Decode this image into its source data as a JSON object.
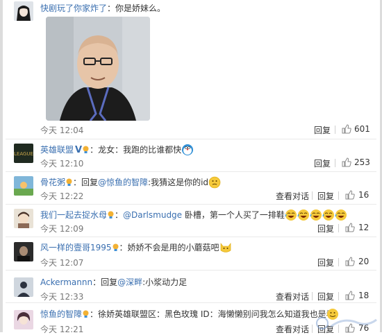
{
  "comments": [
    {
      "user": "快剧玩了你家炸了",
      "text": "：你是娇妹么。",
      "time": "今天 12:04",
      "reply": "回复",
      "likes": "601"
    },
    {
      "user": "英雄联盟",
      "text": "：龙女：我跑的比谁都快",
      "time": "今天 12:10",
      "reply": "回复",
      "likes": "253"
    },
    {
      "user": "骨花粥",
      "reply_prefix": "：回复",
      "mention": "@惊鱼的智障",
      "text": ":我猜这是你的id",
      "time": "今天 12:22",
      "view": "查看对话",
      "reply": "回复",
      "likes": "16"
    },
    {
      "user": "我们一起去捉水母",
      "text_prefix": "：",
      "mention": "@Darlsmudge",
      "text": " 卧槽，第一个人买了一排鞋",
      "time": "今天 12:09",
      "reply": "回复",
      "likes": "12"
    },
    {
      "user": "风一样的壹哥1995",
      "text": "：娇娇不会是用的小蘑菇吧",
      "time": "今天 12:07",
      "reply": "回复",
      "likes": "20"
    },
    {
      "user": "Ackermannn",
      "reply_prefix": "：回复",
      "mention": "@深畔",
      "text": ":小浆动力足",
      "time": "今天 12:33",
      "view": "查看对话",
      "reply": "回复",
      "likes": "18"
    },
    {
      "user": "惊鱼的智障",
      "text": "：徐娇英雄联盟区：黑色玫瑰 ID：海懒懒别问我怎么知道我也是看说的",
      "time": "今天 12:21",
      "view": "查看对话",
      "reply": "回复",
      "likes": "76"
    }
  ],
  "colors": {
    "link": "#3a6fb0",
    "muted": "#777777",
    "divider": "#e9e9e9"
  }
}
